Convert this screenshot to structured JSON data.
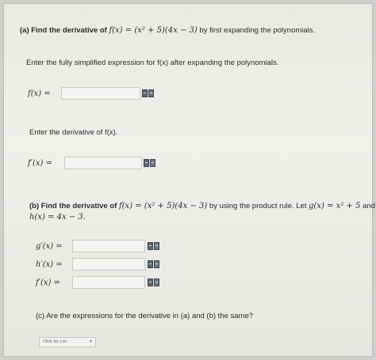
{
  "part_a": {
    "prompt_prefix": "(a) Find the derivative of",
    "function_expr": "f(x) = (x² + 5)(4x − 3)",
    "prompt_suffix": "by first expanding the polynomials.",
    "instruction_1": "Enter the fully simplified expression for f(x) after expanding the polynomials.",
    "label_f": "f(x) =",
    "instruction_2": "Enter the derivative of f(x).",
    "label_fprime": "f′(x) ="
  },
  "part_b": {
    "prompt_line1_prefix": "(b) Find the derivative of",
    "function_expr": "f(x) = (x² + 5)(4x − 3)",
    "prompt_line1_mid": "by using the product rule. Let",
    "g_def": "g(x) = x² + 5",
    "and": "and",
    "h_def": "h(x) = 4x − 3.",
    "label_gprime": "g′(x) =",
    "label_hprime": "h′(x) =",
    "label_fprime": "f′(x) ="
  },
  "part_c": {
    "prompt": "(c) Are the expressions for the derivative in (a) and (b) the same?",
    "select_value": "Click for List"
  }
}
